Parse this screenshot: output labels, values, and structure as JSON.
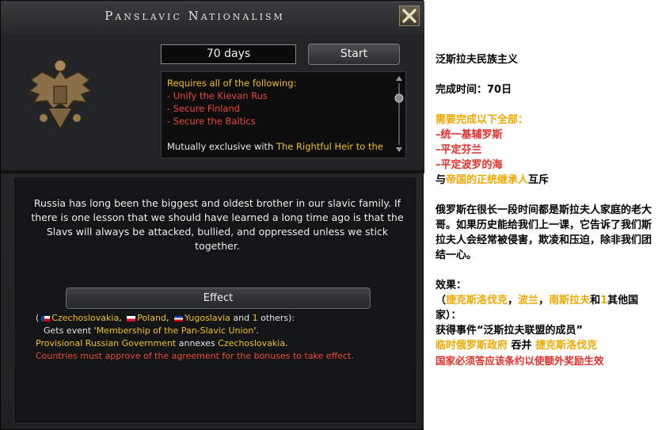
{
  "window": {
    "title": "Panslavic Nationalism"
  },
  "focus": {
    "duration_label": "70 days",
    "start_label": "Start",
    "requirements": {
      "header": "Requires all of the following:",
      "items": [
        "- Unify the Kievan Rus",
        "- Secure Finland",
        "- Secure the Baltics"
      ],
      "mutex_prefix": "Mutually exclusive with ",
      "mutex_target": "The Rightful Heir to the"
    },
    "description": "Russia has long been the biggest and oldest brother in our slavic family. If there is one lesson that we should have learned a long time ago is that the Slavs will always be attacked, bullied, and oppressed unless we stick together.",
    "effect_label": "Effect",
    "effects": {
      "open_paren": "(",
      "countries": [
        "Czechoslovakia",
        "Poland",
        "Yugoslavia"
      ],
      "sep1": ", ",
      "and_text": " and ",
      "others_count": "1",
      "others_text": " others):",
      "event_prefix": "Gets event '",
      "event_name": "Membership of the Pan-Slavic Union",
      "event_suffix": "'.",
      "annex_subject": "Provisional Russian Government",
      "annex_verb": " annexes ",
      "annex_target": "Czechoslovakia",
      "annex_end": ".",
      "approval_note": "Countries must approve of the agreement for the bonuses to take effect."
    }
  },
  "translation": {
    "title": "泛斯拉夫民族主义",
    "time_label": "完成时间：70日",
    "req_header": "需要完成以下全部：",
    "req_items": [
      "–统一基辅罗斯",
      "–平定芬兰",
      "–平定波罗的海"
    ],
    "mutex_pre": "与",
    "mutex_target": "帝国的正统继承人",
    "mutex_post": "互斥",
    "description": "俄罗斯在很长一段时间都是斯拉夫人家庭的老大哥。如果历史能给我们上一课，它告诉了我们斯拉夫人会经常被侵害，欺凌和压迫，除非我们团结一心。",
    "effect_header": "效果：",
    "eff_open": "（",
    "eff_c1": "捷克斯洛伐克",
    "eff_sep1": "，",
    "eff_c2": "波兰",
    "eff_sep2": "，",
    "eff_c3": "南斯拉夫",
    "eff_and": "和",
    "eff_num": "1",
    "eff_others": "其他国家",
    "eff_close": "）：",
    "event_line": "获得事件“泛斯拉夫联盟的成员”",
    "annex_subject": "临时俄罗斯政府",
    "annex_verb": " 吞并 ",
    "annex_target": "捷克斯洛伐克",
    "approval_note": "国家必须答应该条约以使额外奖励生效"
  }
}
